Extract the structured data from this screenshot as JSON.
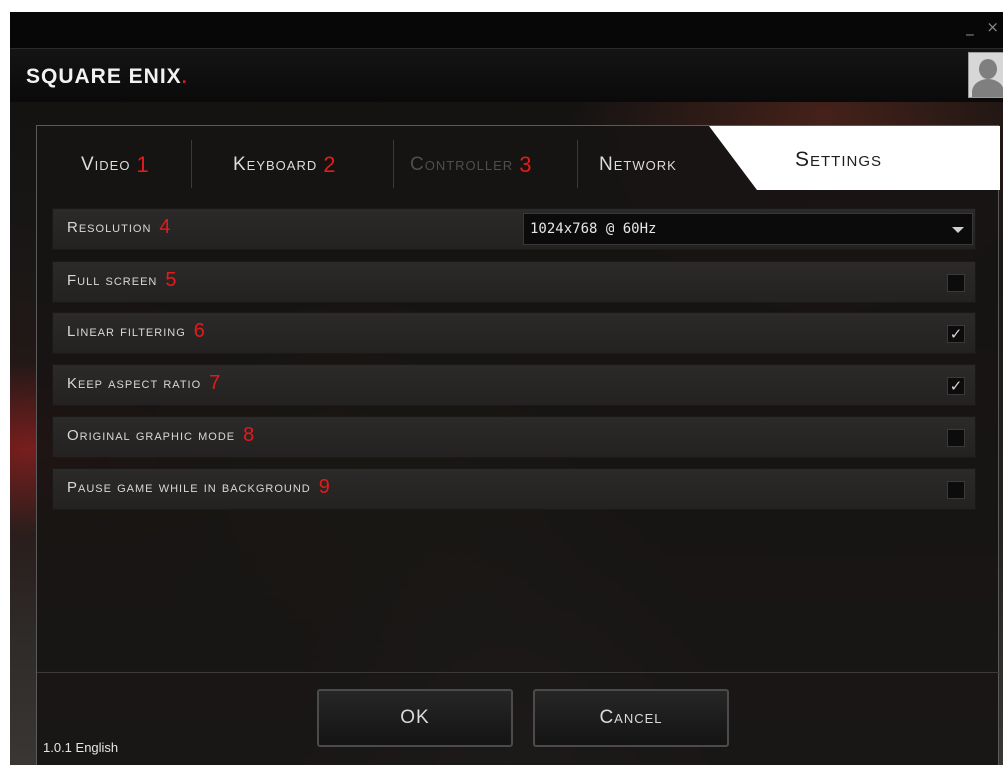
{
  "window": {
    "controls": "_ ×"
  },
  "brand": {
    "logo": "SQUARE ENIX",
    "logo_dot": "."
  },
  "tabs": [
    {
      "label": "Video",
      "marker": "1",
      "state": "normal"
    },
    {
      "label": "Keyboard",
      "marker": "2",
      "state": "normal"
    },
    {
      "label": "Controller",
      "marker": "3",
      "state": "disabled"
    },
    {
      "label": "Network",
      "marker": "",
      "state": "normal"
    }
  ],
  "settings_tab": {
    "label": "Settings"
  },
  "rows": [
    {
      "label": "Resolution",
      "marker": "4",
      "type": "select",
      "value": "1024x768 @ 60Hz"
    },
    {
      "label": "Full screen",
      "marker": "5",
      "type": "checkbox",
      "checked": false
    },
    {
      "label": "Linear filtering",
      "marker": "6",
      "type": "checkbox",
      "checked": true
    },
    {
      "label": "Keep aspect ratio",
      "marker": "7",
      "type": "checkbox",
      "checked": true
    },
    {
      "label": "Original graphic mode",
      "marker": "8",
      "type": "checkbox",
      "checked": false
    },
    {
      "label": "Pause game while in background",
      "marker": "9",
      "type": "checkbox",
      "checked": false
    }
  ],
  "checkmark_glyph": "✓",
  "buttons": {
    "ok": "OK",
    "cancel": "Cancel"
  },
  "version": "1.0.1 English",
  "colors": {
    "marker": "#e21b1b",
    "logo_dot": "#cc1f1f",
    "active_tab": "#ffffff"
  }
}
